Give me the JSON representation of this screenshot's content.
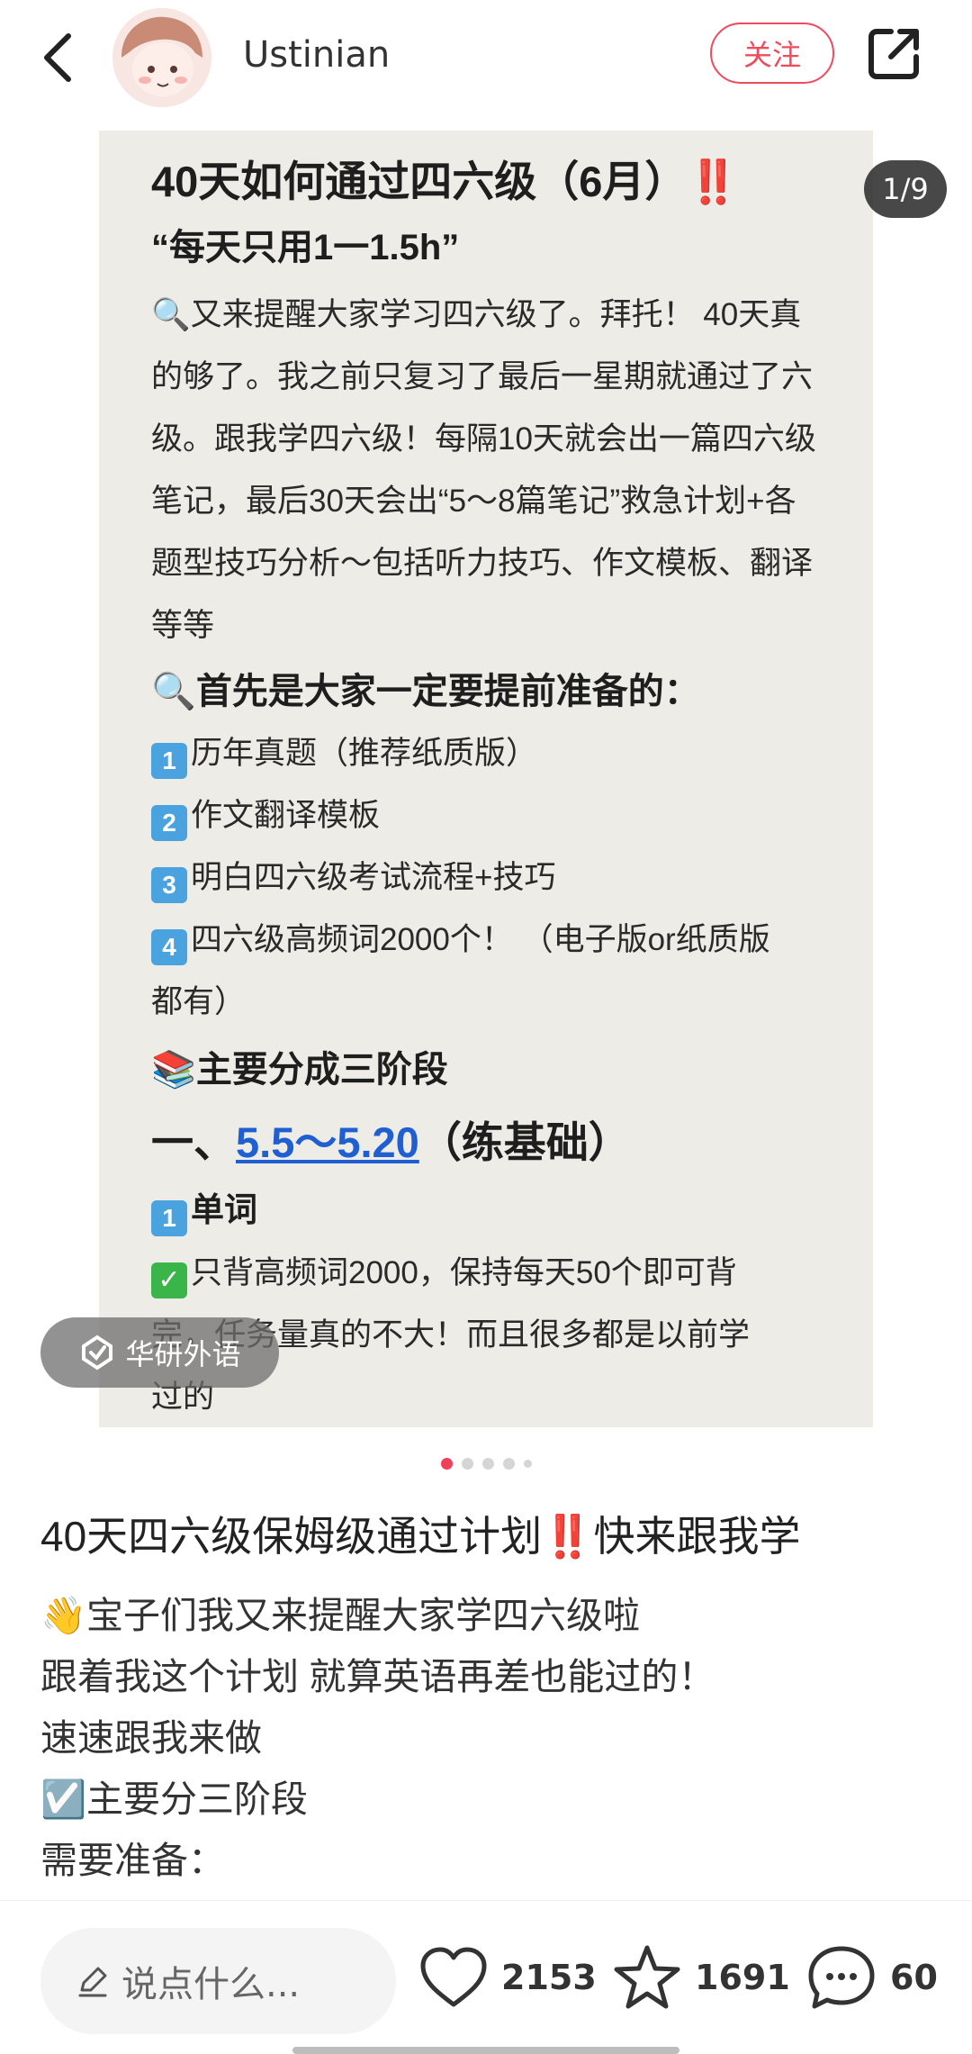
{
  "header": {
    "author_name": "Ustinian",
    "follow_label": "关注"
  },
  "carousel": {
    "page_indicator": "1/9",
    "watermark": "华研外语",
    "dot_count": 5,
    "active_dot": 0,
    "note": {
      "title": "40天如何通过四六级（6月）",
      "title_emoji": "‼️",
      "subtitle": "“每天只用1一1.5h”",
      "intro": "🔍又来提醒大家学习四六级了。拜托！ 40天真的够了。我之前只复习了最后一星期就通过了六级。跟我学四六级！每隔10天就会出一篇四六级笔记，最后30天会出“5～8篇笔记”救急计划+各题型技巧分析～包括听力技巧、作文模板、翻译等等",
      "prep_heading": "首先是大家一定要提前准备的：",
      "prep_items": [
        {
          "num": "1",
          "text": "历年真题（推荐纸质版）"
        },
        {
          "num": "2",
          "text": "作文翻译模板"
        },
        {
          "num": "3",
          "text": "明白四六级考试流程+技巧"
        },
        {
          "num": "4",
          "text": "四六级高频词2000个！ （电子版or纸质版"
        }
      ],
      "prep_item4_cont": "都有）",
      "stages_heading": "主要分成三阶段",
      "stage1_prefix": "一、",
      "stage1_dates": "5.5～5.20",
      "stage1_suffix": "（练基础）",
      "words_heading": "单词",
      "words_line1": "只背高频词2000，保持每天50个即可背",
      "words_line2": "完，任务量真的不大！而且很多都是以前学",
      "words_line3": "过的"
    }
  },
  "post": {
    "title": "40天四六级保姆级通过计划‼️快来跟我学",
    "lines": [
      "👋宝子们我又来提醒大家学四六级啦",
      "跟着我这个计划 就算英语再差也能过的！",
      "速速跟我来做",
      "☑️主要分三阶段",
      "需要准备："
    ]
  },
  "bottom_bar": {
    "comment_placeholder": "说点什么...",
    "likes": "2153",
    "collects": "1691",
    "comments": "60"
  },
  "colors": {
    "accent": "#ef4b5c",
    "note_bg": "#edece7",
    "link": "#1f5fd1"
  },
  "icons": [
    "back-arrow-icon",
    "share-icon",
    "pencil-icon",
    "heart-icon",
    "star-icon",
    "comment-bubble-icon"
  ]
}
